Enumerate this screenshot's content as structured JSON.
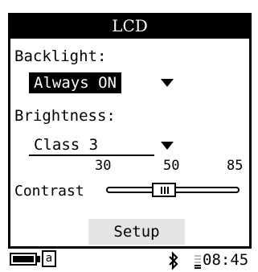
{
  "window": {
    "title": "LCD"
  },
  "backlight": {
    "label": "Backlight:",
    "value": "Always ON"
  },
  "brightness": {
    "label": "Brightness:",
    "value": "Class 3"
  },
  "contrast": {
    "label": "Contrast",
    "ticks": [
      "30",
      "50",
      "85"
    ],
    "min": 30,
    "max": 85,
    "value": 50
  },
  "setup_button": {
    "label": "Setup"
  },
  "status": {
    "battery_level": 1.0,
    "input_mode": "a",
    "bluetooth_icon": "bluetooth-icon",
    "signal_icon": "signal-icon",
    "time": "08:45"
  }
}
